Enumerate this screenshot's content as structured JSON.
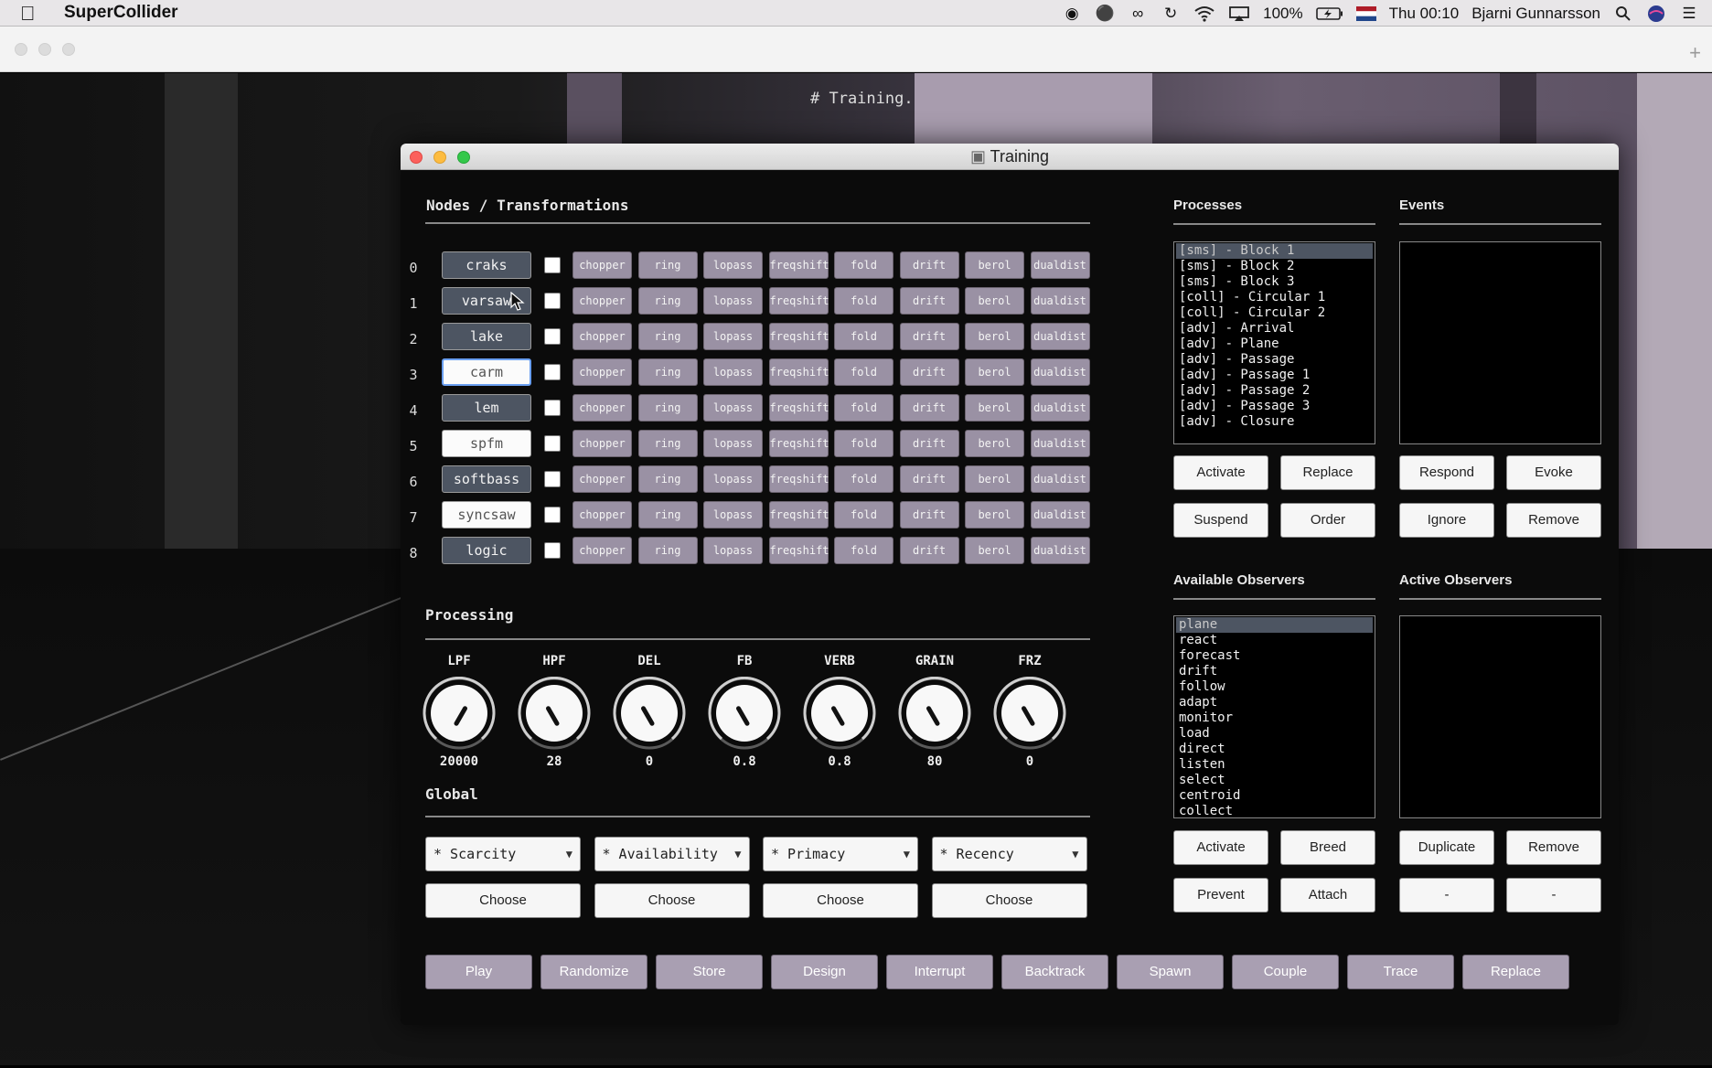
{
  "menubar": {
    "app_name": "SuperCollider",
    "battery": "100%",
    "clock": "Thu 00:10",
    "user": "Bjarni Gunnarsson",
    "icons": [
      "record-icon",
      "balloon-icon",
      "creative-cloud-icon",
      "time-machine-icon",
      "wifi-icon",
      "airplay-icon",
      "battery-icon",
      "flag-icon",
      "spotlight-icon",
      "siri-icon",
      "notification-icon"
    ]
  },
  "document": {
    "heading": "# Training."
  },
  "window": {
    "title": "Training"
  },
  "nodes": {
    "title": "Nodes / Transformations",
    "rows": [
      {
        "index": "0",
        "name": "craks",
        "style": "dark"
      },
      {
        "index": "1",
        "name": "varsaw",
        "style": "dark"
      },
      {
        "index": "2",
        "name": "lake",
        "style": "dark"
      },
      {
        "index": "3",
        "name": "carm",
        "style": "light-selected"
      },
      {
        "index": "4",
        "name": "lem",
        "style": "dark"
      },
      {
        "index": "5",
        "name": "spfm",
        "style": "light"
      },
      {
        "index": "6",
        "name": "softbass",
        "style": "dark"
      },
      {
        "index": "7",
        "name": "syncsaw",
        "style": "light"
      },
      {
        "index": "8",
        "name": "logic",
        "style": "dark"
      }
    ],
    "transforms": [
      "chopper",
      "ring",
      "lopass",
      "freqshift",
      "fold",
      "drift",
      "berol",
      "dualdist"
    ]
  },
  "processing": {
    "title": "Processing",
    "knobs": [
      {
        "label": "LPF",
        "value": "20000",
        "angle": -30
      },
      {
        "label": "HPF",
        "value": "28",
        "angle": 30
      },
      {
        "label": "DEL",
        "value": "0",
        "angle": 30
      },
      {
        "label": "FB",
        "value": "0.8",
        "angle": 30
      },
      {
        "label": "VERB",
        "value": "0.8",
        "angle": 30
      },
      {
        "label": "GRAIN",
        "value": "80",
        "angle": 30
      },
      {
        "label": "FRZ",
        "value": "0",
        "angle": 30
      }
    ]
  },
  "global": {
    "title": "Global",
    "selects": [
      "* Scarcity",
      "* Availability",
      "* Primacy",
      "* Recency"
    ],
    "choose_label": "Choose"
  },
  "processes": {
    "title": "Processes",
    "items": [
      "[sms] - Block 1",
      "[sms] - Block 2",
      "[sms] - Block 3",
      "[coll] - Circular 1",
      "[coll] - Circular 2",
      "[adv] - Arrival",
      "[adv] - Plane",
      "[adv] - Passage",
      "[adv] - Passage 1",
      "[adv] - Passage 2",
      "[adv] - Passage 3",
      "[adv] - Closure"
    ],
    "buttons": [
      "Activate",
      "Replace",
      "Suspend",
      "Order"
    ]
  },
  "events": {
    "title": "Events",
    "items": [],
    "buttons": [
      "Respond",
      "Evoke",
      "Ignore",
      "Remove"
    ]
  },
  "available_observers": {
    "title": "Available Observers",
    "items": [
      "plane",
      "react",
      "forecast",
      "drift",
      "follow",
      "adapt",
      "monitor",
      "load",
      "direct",
      "listen",
      "select",
      "centroid",
      "collect"
    ],
    "buttons": [
      "Activate",
      "Breed",
      "Prevent",
      "Attach"
    ]
  },
  "active_observers": {
    "title": "Active Observers",
    "items": [],
    "buttons": [
      "Duplicate",
      "Remove",
      "-",
      "-"
    ]
  },
  "bottom_buttons": [
    "Play",
    "Randomize",
    "Store",
    "Design",
    "Interrupt",
    "Backtrack",
    "Spawn",
    "Couple",
    "Trace",
    "Replace"
  ],
  "colors": {
    "node_dark": "#4d5562",
    "transform": "#9a91a4",
    "bottom_button": "#a99fb2",
    "selection": "#6a9ff0"
  }
}
